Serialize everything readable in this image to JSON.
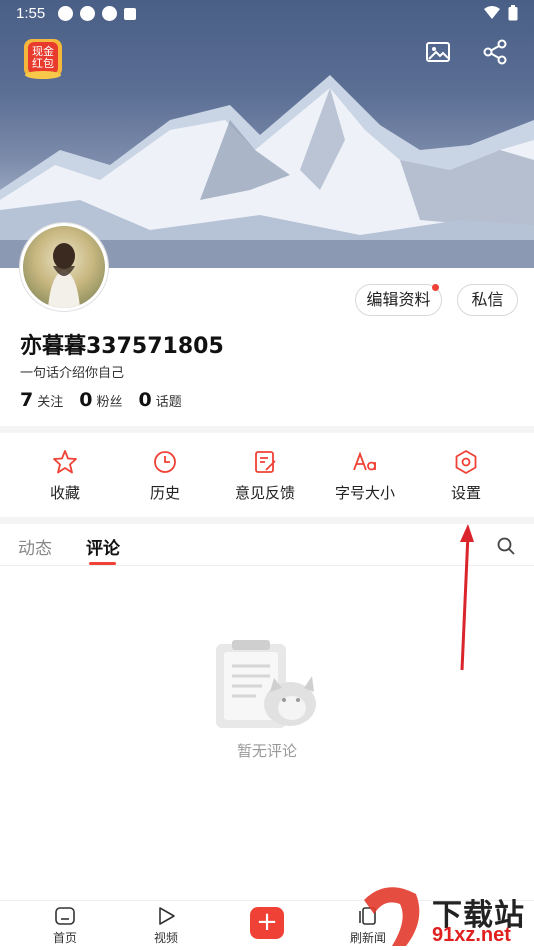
{
  "status": {
    "time": "1:55"
  },
  "header": {
    "red_packet": {
      "line1": "现金",
      "line2": "红包"
    },
    "icons": [
      "image-icon",
      "share-icon"
    ]
  },
  "profile": {
    "username": "亦暮暮337571805",
    "bio": "一句话介绍你自己",
    "edit_button": "编辑资料",
    "message_button": "私信",
    "stats": [
      {
        "num": "7",
        "label": "关注"
      },
      {
        "num": "0",
        "label": "粉丝"
      },
      {
        "num": "0",
        "label": "话题"
      }
    ]
  },
  "quick_actions": [
    {
      "label": "收藏",
      "icon": "star-icon"
    },
    {
      "label": "历史",
      "icon": "clock-icon"
    },
    {
      "label": "意见反馈",
      "icon": "feedback-icon"
    },
    {
      "label": "字号大小",
      "icon": "font-size-icon"
    },
    {
      "label": "设置",
      "icon": "settings-icon"
    }
  ],
  "tabs": [
    {
      "label": "动态",
      "active": false
    },
    {
      "label": "评论",
      "active": true
    }
  ],
  "empty_state": {
    "text": "暂无评论"
  },
  "bottom_nav": [
    {
      "label": "首页",
      "icon": "home-icon"
    },
    {
      "label": "视频",
      "icon": "play-icon"
    },
    {
      "label": "+",
      "icon": "plus-icon"
    },
    {
      "label": "刷新闻",
      "icon": "news-icon"
    }
  ],
  "watermark": {
    "title": "下载站",
    "domain": "91xz.net"
  },
  "colors": {
    "accent": "#f04136",
    "text": "#222222",
    "muted": "#999999"
  }
}
